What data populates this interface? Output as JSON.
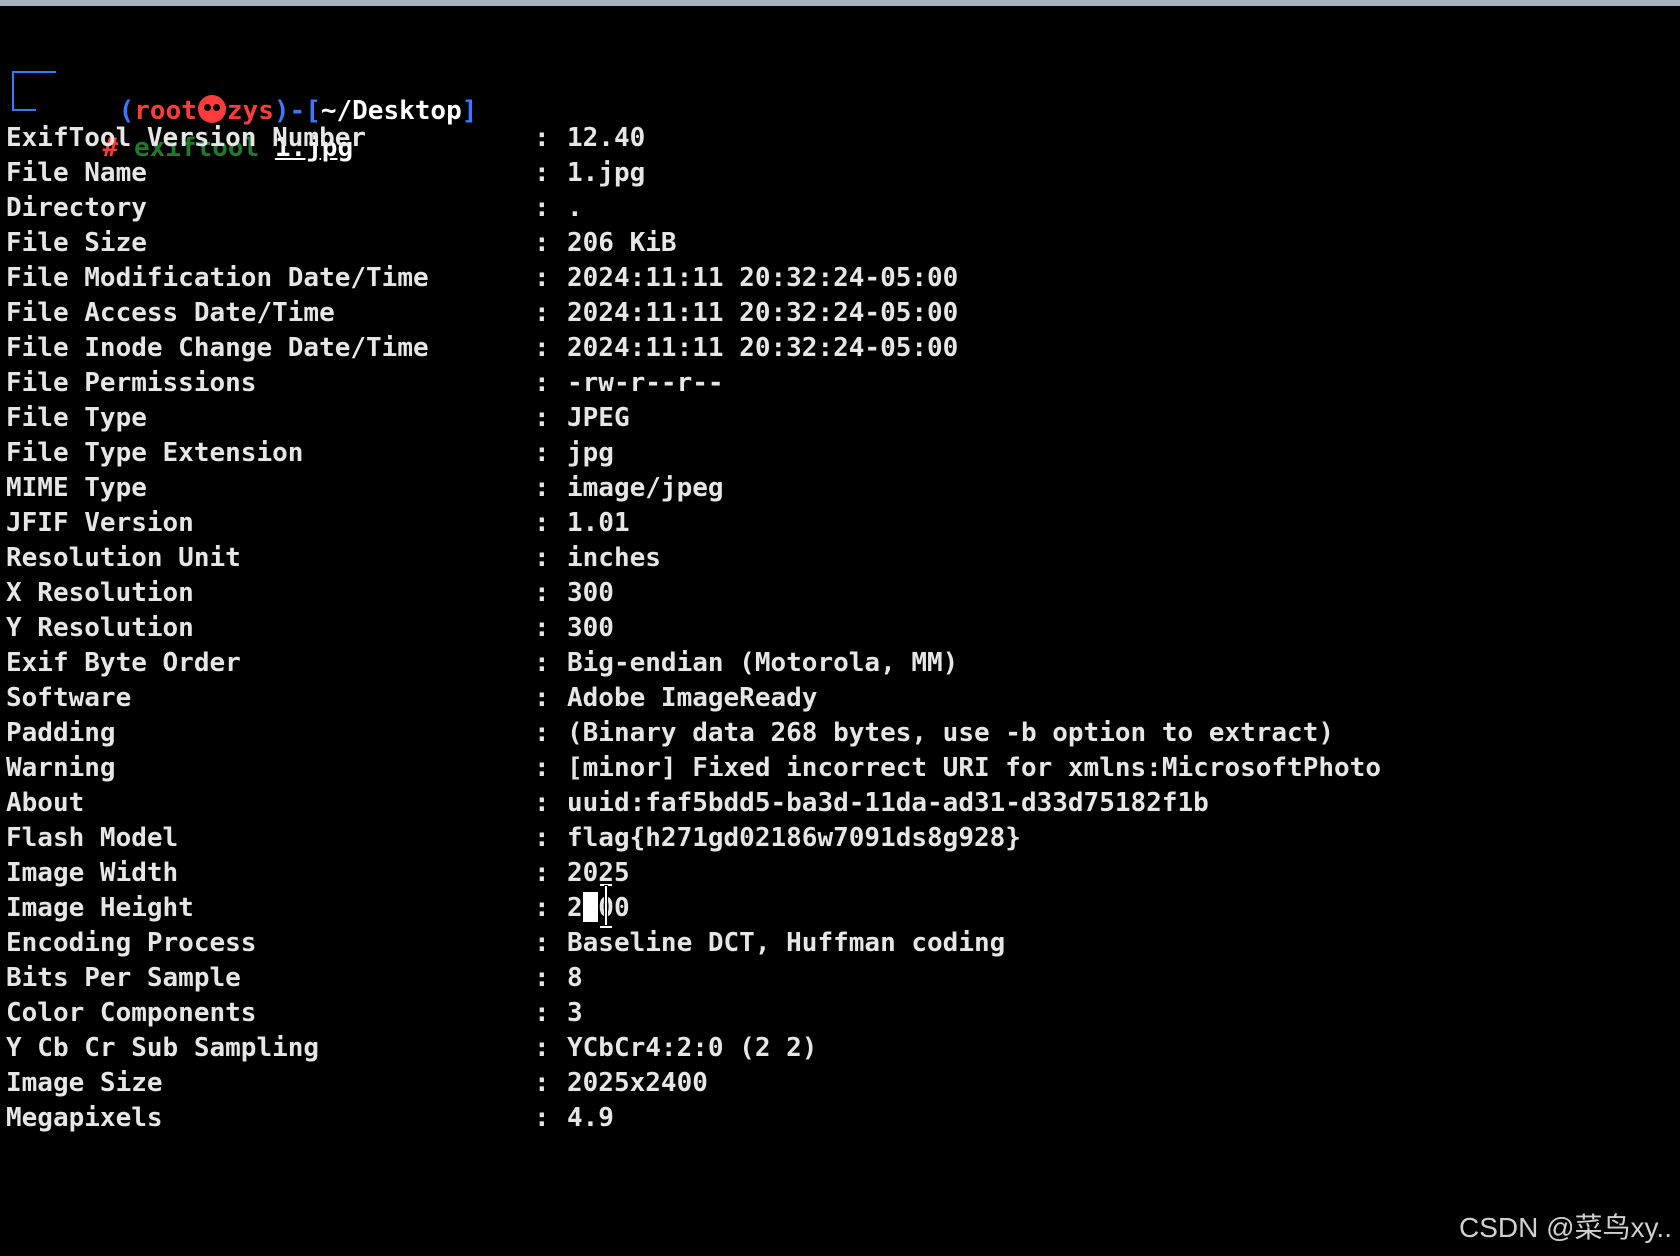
{
  "prompt": {
    "open_paren": "(",
    "user": "root",
    "host": "zys",
    "close_paren": ")",
    "dash": "-",
    "open_bracket": "[",
    "cwd": "~/Desktop",
    "close_bracket": "]",
    "hash": "#",
    "command": "exiftool",
    "argument": "1.jpg"
  },
  "separator": ":",
  "rows": [
    {
      "key": "ExifTool Version Number",
      "value": "12.40"
    },
    {
      "key": "File Name",
      "value": "1.jpg"
    },
    {
      "key": "Directory",
      "value": "."
    },
    {
      "key": "File Size",
      "value": "206 KiB"
    },
    {
      "key": "File Modification Date/Time",
      "value": "2024:11:11 20:32:24-05:00"
    },
    {
      "key": "File Access Date/Time",
      "value": "2024:11:11 20:32:24-05:00"
    },
    {
      "key": "File Inode Change Date/Time",
      "value": "2024:11:11 20:32:24-05:00"
    },
    {
      "key": "File Permissions",
      "value": "-rw-r--r--"
    },
    {
      "key": "File Type",
      "value": "JPEG"
    },
    {
      "key": "File Type Extension",
      "value": "jpg"
    },
    {
      "key": "MIME Type",
      "value": "image/jpeg"
    },
    {
      "key": "JFIF Version",
      "value": "1.01"
    },
    {
      "key": "Resolution Unit",
      "value": "inches"
    },
    {
      "key": "X Resolution",
      "value": "300"
    },
    {
      "key": "Y Resolution",
      "value": "300"
    },
    {
      "key": "Exif Byte Order",
      "value": "Big-endian (Motorola, MM)"
    },
    {
      "key": "Software",
      "value": "Adobe ImageReady"
    },
    {
      "key": "Padding",
      "value": "(Binary data 268 bytes, use -b option to extract)"
    },
    {
      "key": "Warning",
      "value": "[minor] Fixed incorrect URI for xmlns:MicrosoftPhoto"
    },
    {
      "key": "About",
      "value": "uuid:faf5bdd5-ba3d-11da-ad31-d33d75182f1b"
    },
    {
      "key": "Flash Model",
      "value": "flag{h271gd02186w7091ds8g928}"
    },
    {
      "key": "Image Width",
      "value": "2025"
    },
    {
      "key": "Image Height",
      "value": "2400"
    },
    {
      "key": "Encoding Process",
      "value": "Baseline DCT, Huffman coding"
    },
    {
      "key": "Bits Per Sample",
      "value": "8"
    },
    {
      "key": "Color Components",
      "value": "3"
    },
    {
      "key": "Y Cb Cr Sub Sampling",
      "value": "YCbCr4:2:0 (2 2)"
    },
    {
      "key": "Image Size",
      "value": "2025x2400"
    },
    {
      "key": "Megapixels",
      "value": "4.9"
    }
  ],
  "watermark": "CSDN @菜鸟xy..",
  "colors": {
    "background": "#000000",
    "text": "#e6e6e6",
    "prompt_blue": "#3b78ff",
    "prompt_red": "#ff3c3c",
    "command_green": "#1f7a2e"
  },
  "icons": {
    "host_separator": "skull-icon",
    "mouse_cursor": "ibeam-cursor-icon"
  }
}
